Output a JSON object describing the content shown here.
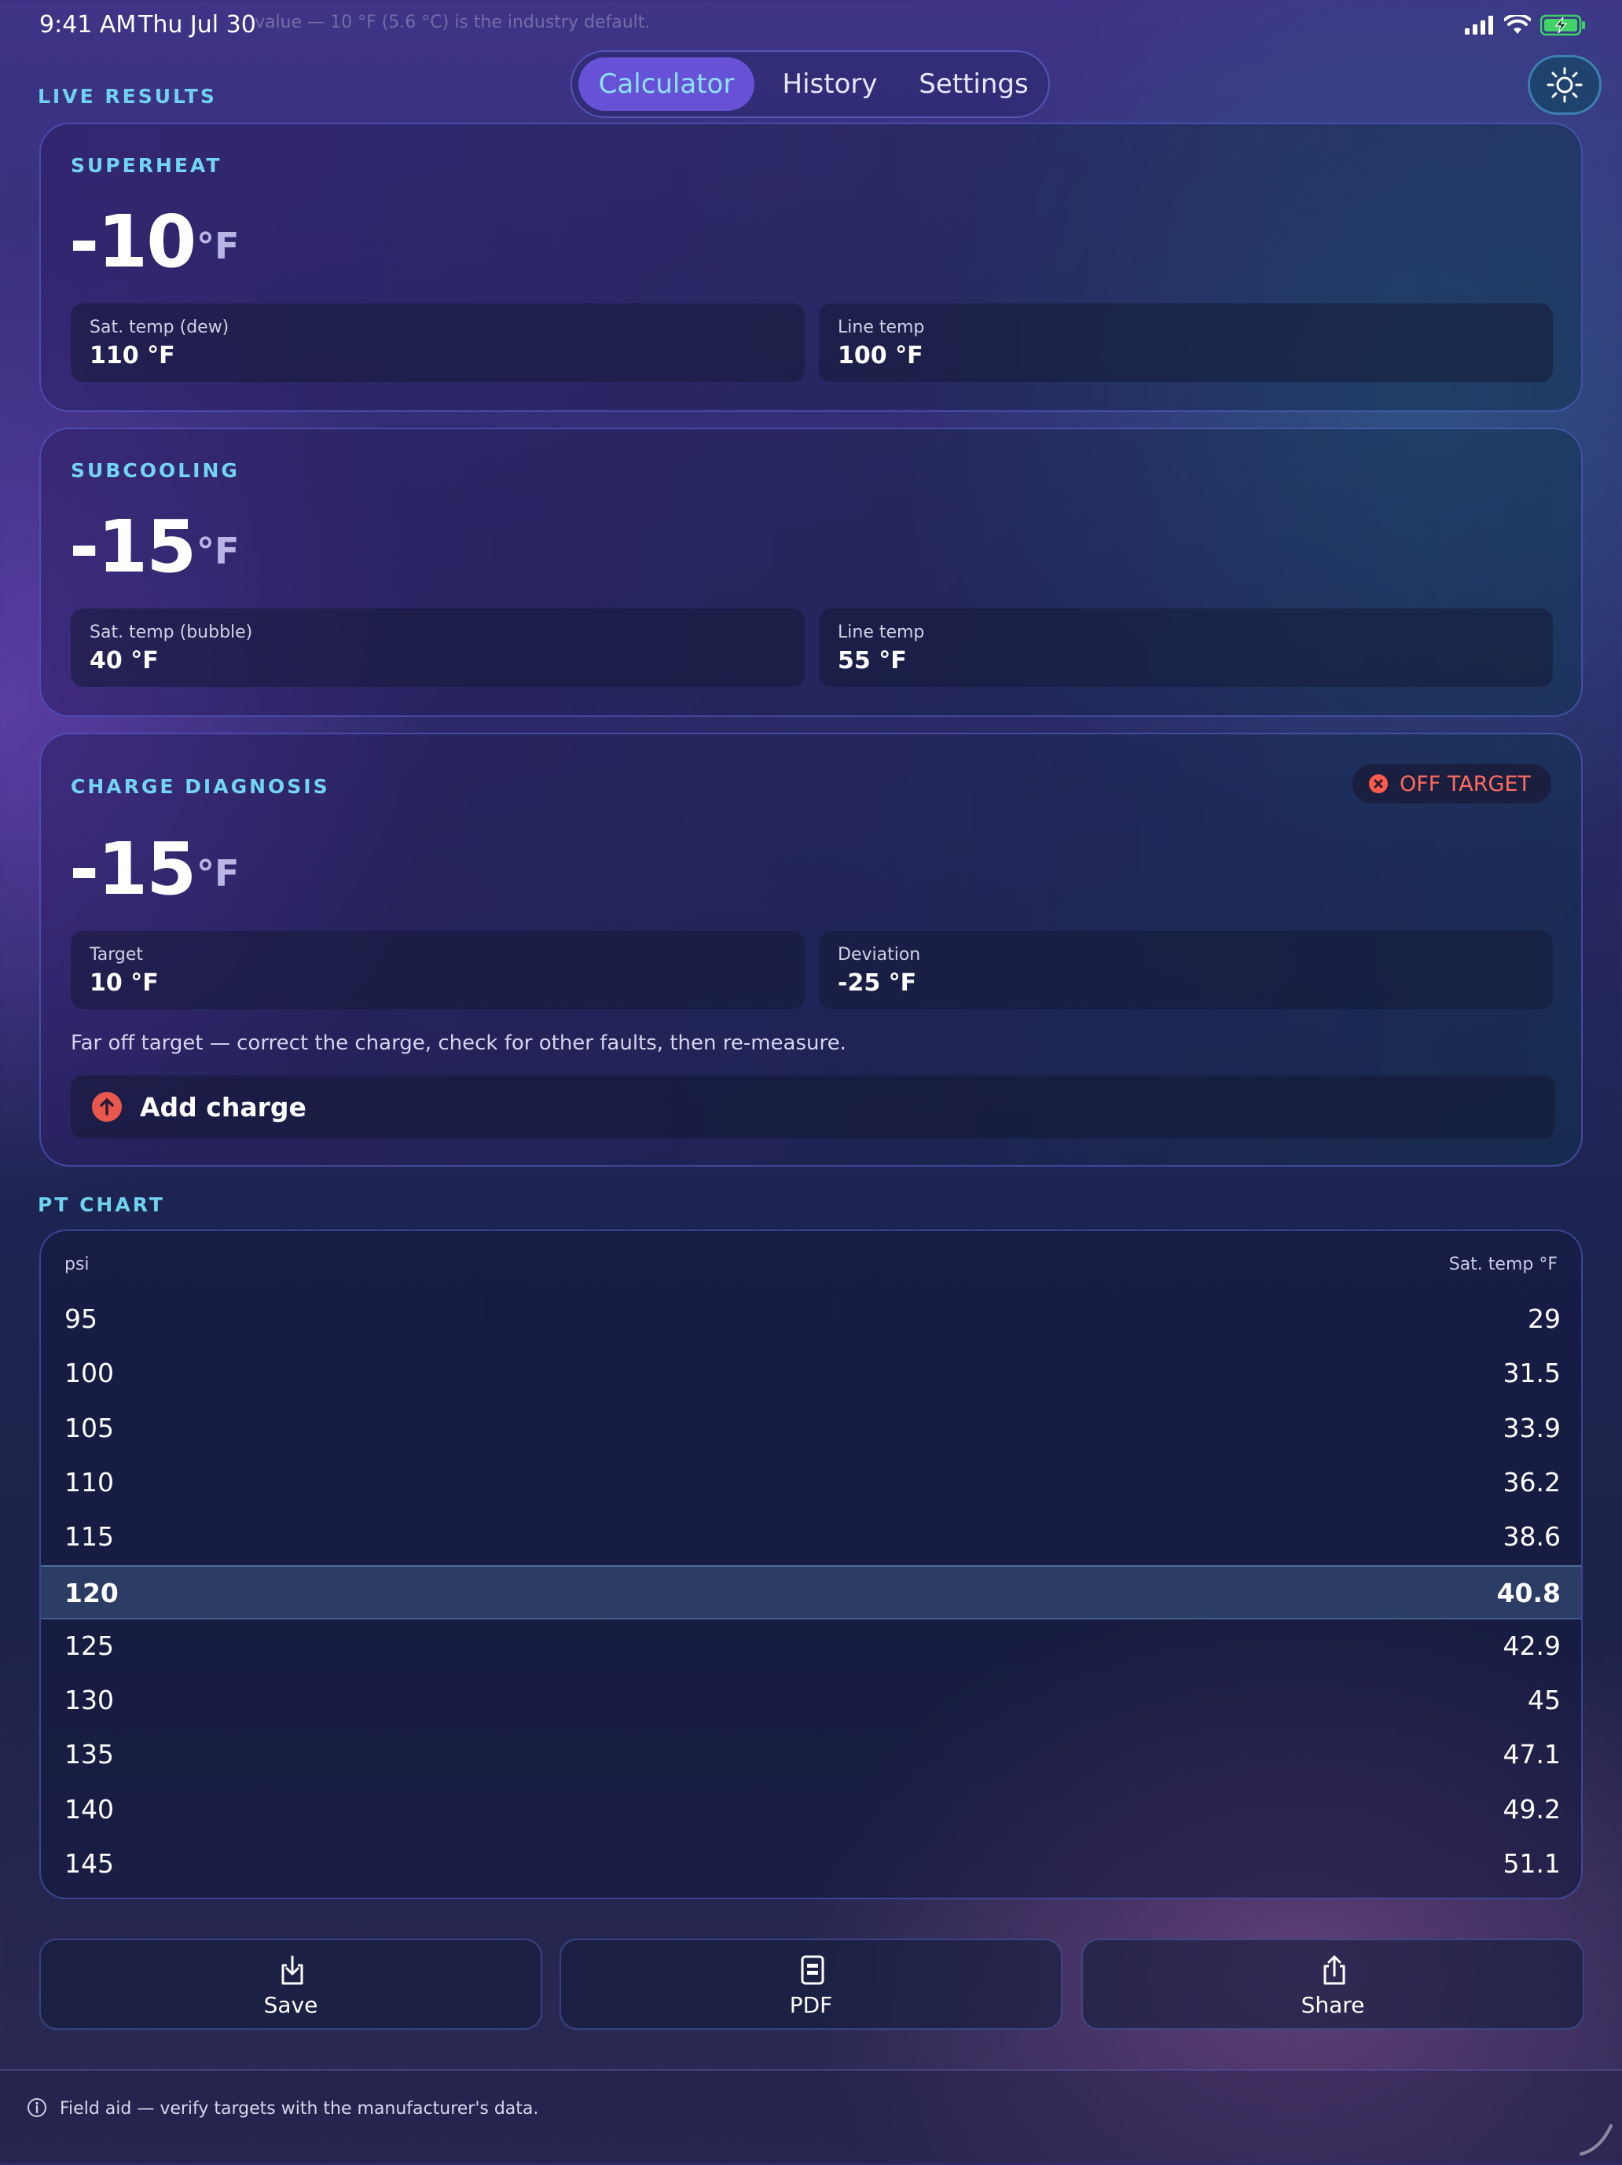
{
  "status": {
    "time": "9:41 AM",
    "date": "Thu Jul 30",
    "ghost_text": "value — 10 °F (5.6 °C) is the industry default."
  },
  "nav": {
    "tabs": [
      "Calculator",
      "History",
      "Settings"
    ],
    "active": "Calculator",
    "theme_icon": "sun-icon"
  },
  "live_results_label": "LIVE RESULTS",
  "superheat": {
    "title": "SUPERHEAT",
    "value": "-10",
    "unit": "°F",
    "left_label": "Sat. temp (dew)",
    "left_value": "110 °F",
    "right_label": "Line temp",
    "right_value": "100 °F"
  },
  "subcooling": {
    "title": "SUBCOOLING",
    "value": "-15",
    "unit": "°F",
    "left_label": "Sat. temp (bubble)",
    "left_value": "40 °F",
    "right_label": "Line temp",
    "right_value": "55 °F"
  },
  "diagnosis": {
    "title": "CHARGE DIAGNOSIS",
    "badge": "OFF TARGET",
    "badge_color": "#ff6b5c",
    "value": "-15",
    "unit": "°F",
    "left_label": "Target",
    "left_value": "10 °F",
    "right_label": "Deviation",
    "right_value": "-25 °F",
    "note": "Far off target — correct the charge, check for other faults, then re-measure.",
    "action": "Add charge"
  },
  "pt_chart": {
    "label": "PT CHART",
    "col_psi": "psi",
    "col_temp": "Sat. temp °F",
    "highlight_psi": "120",
    "rows": [
      {
        "psi": "95",
        "temp": "29"
      },
      {
        "psi": "100",
        "temp": "31.5"
      },
      {
        "psi": "105",
        "temp": "33.9"
      },
      {
        "psi": "110",
        "temp": "36.2"
      },
      {
        "psi": "115",
        "temp": "38.6"
      },
      {
        "psi": "120",
        "temp": "40.8"
      },
      {
        "psi": "125",
        "temp": "42.9"
      },
      {
        "psi": "130",
        "temp": "45"
      },
      {
        "psi": "135",
        "temp": "47.1"
      },
      {
        "psi": "140",
        "temp": "49.2"
      },
      {
        "psi": "145",
        "temp": "51.1"
      }
    ]
  },
  "actions": {
    "save": "Save",
    "pdf": "PDF",
    "share": "Share"
  },
  "footer": {
    "text": "Field aid — verify targets with the manufacturer's data."
  },
  "colors": {
    "accent": "#6751d6",
    "cyan": "#72d6f2",
    "alert": "#ff6b5c"
  }
}
